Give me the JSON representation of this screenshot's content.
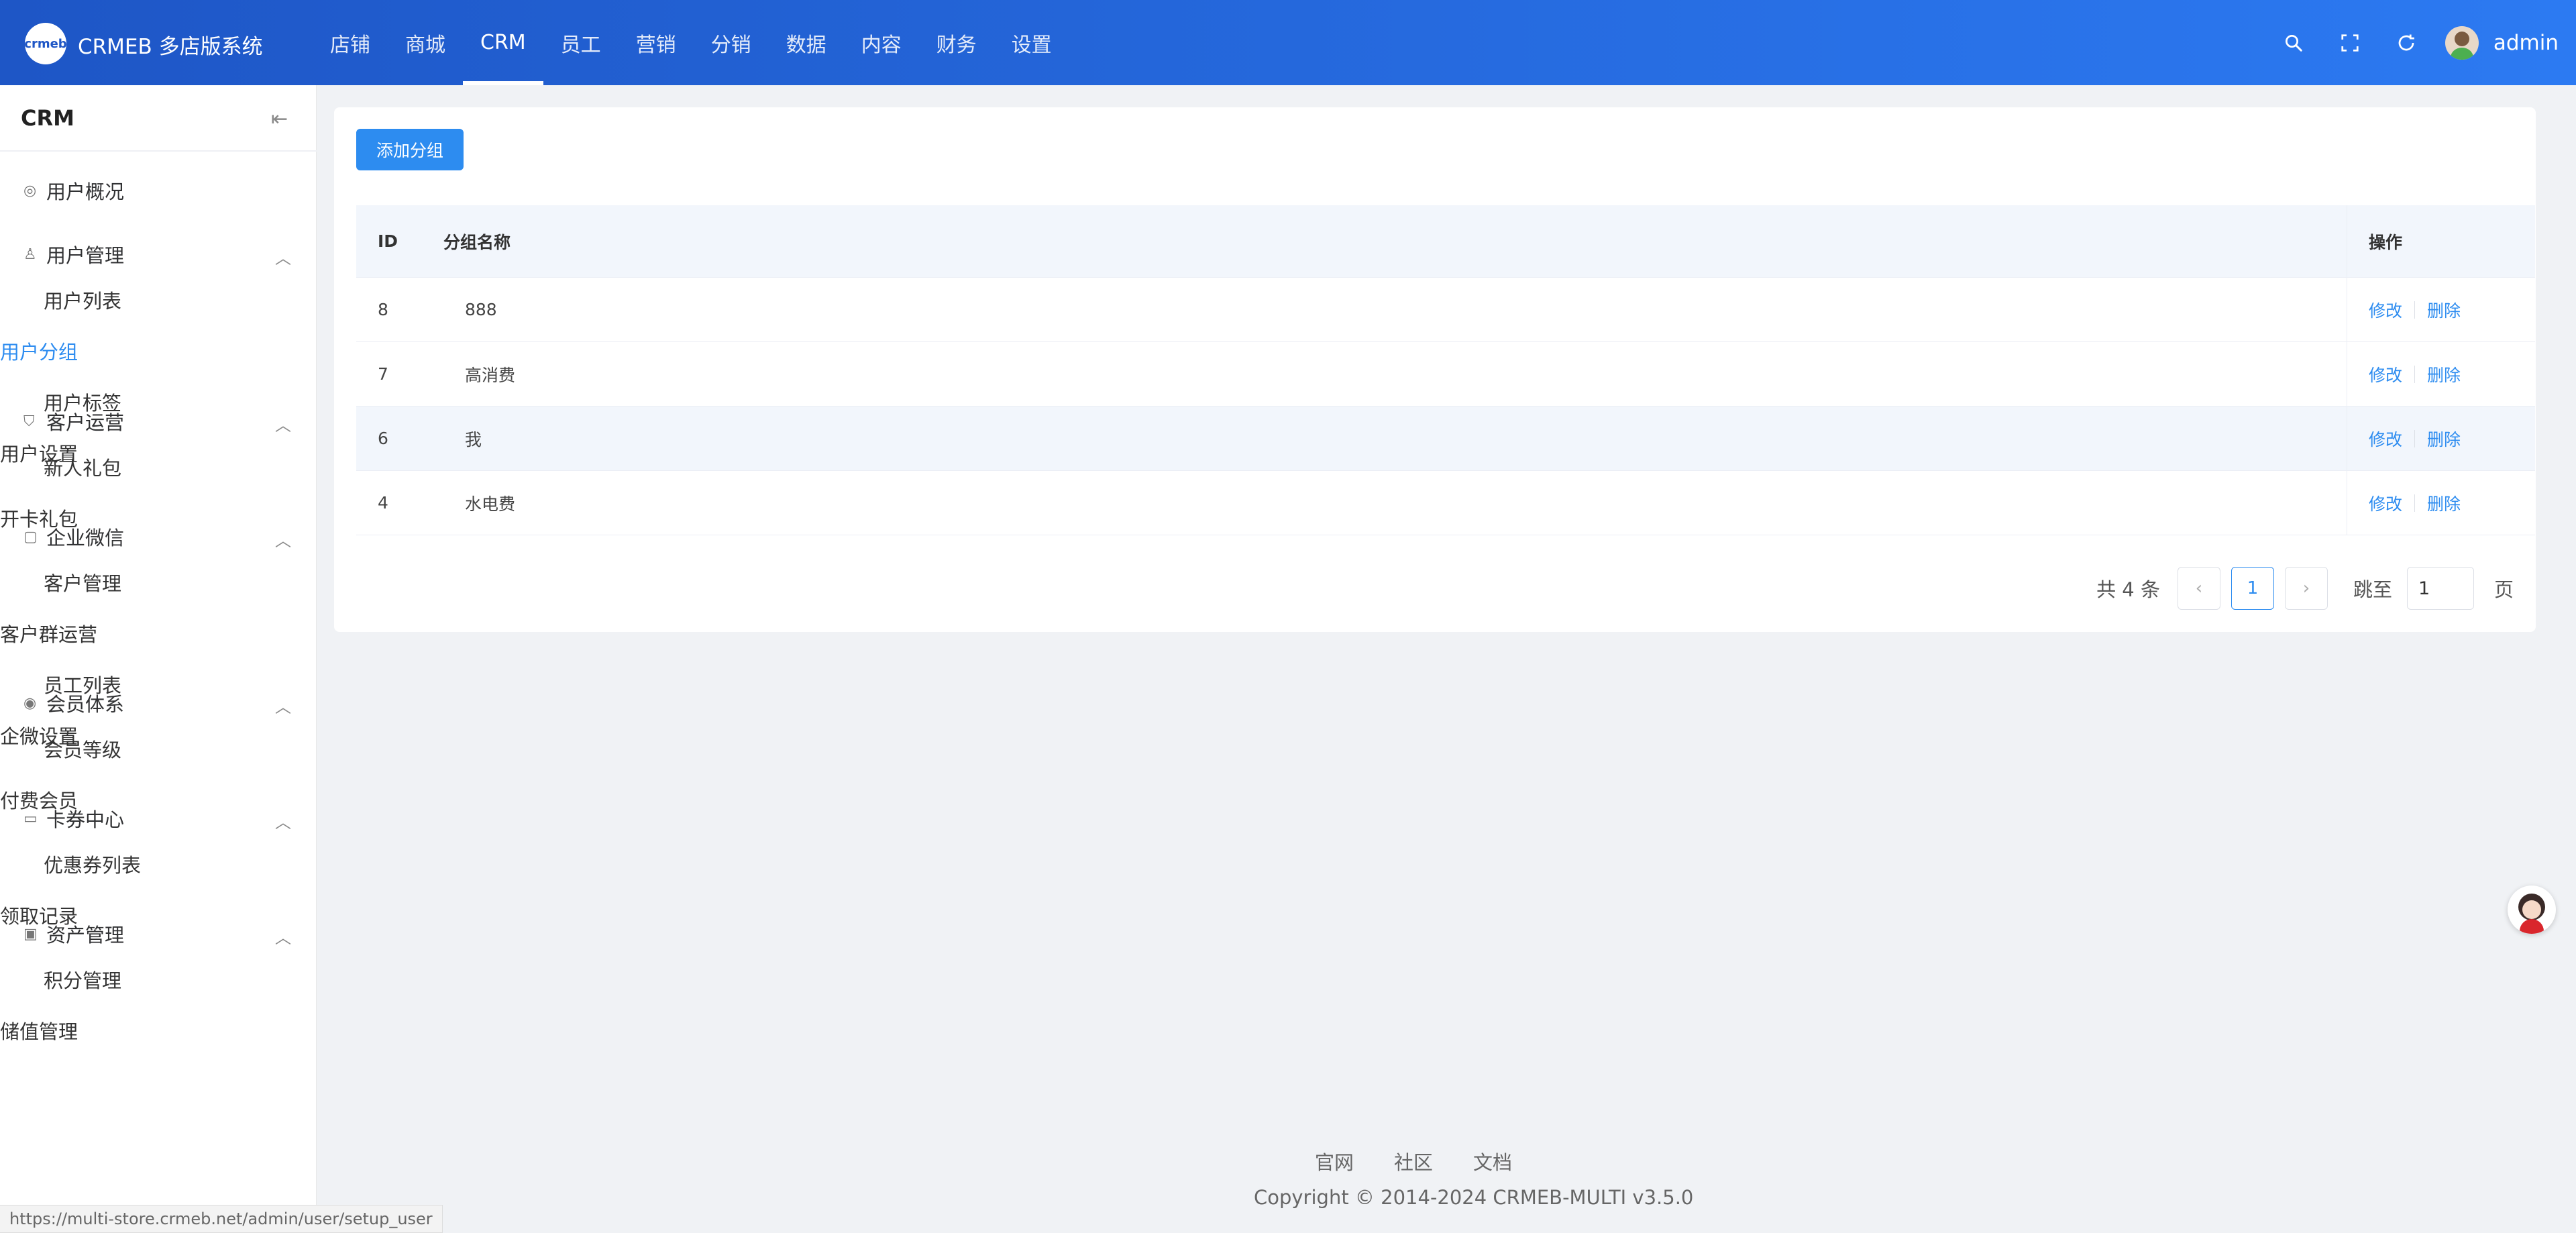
{
  "header": {
    "logo_text": "crmeb",
    "brand": "CRMEB 多店版系统",
    "nav": [
      "店铺",
      "商城",
      "CRM",
      "员工",
      "营销",
      "分销",
      "数据",
      "内容",
      "财务",
      "设置"
    ],
    "active_nav": "CRM",
    "user": "admin",
    "icons": [
      "search-icon",
      "fullscreen-icon",
      "refresh-icon"
    ]
  },
  "sidebar": {
    "title": "CRM",
    "collapse_icon": "collapse-left-icon",
    "groups": [
      {
        "label": "用户概况",
        "icon": "dashboard-icon",
        "items": []
      },
      {
        "label": "用户管理",
        "icon": "user-icon",
        "items": [
          "用户列表",
          "用户分组",
          "用户标签",
          "用户设置"
        ]
      },
      {
        "label": "客户运营",
        "icon": "shield-icon",
        "items": [
          "新人礼包",
          "开卡礼包"
        ]
      },
      {
        "label": "企业微信",
        "icon": "chat-icon",
        "items": [
          "客户管理",
          "客户群运营",
          "员工列表",
          "企微设置"
        ]
      },
      {
        "label": "会员体系",
        "icon": "member-icon",
        "items": [
          "会员等级",
          "付费会员"
        ]
      },
      {
        "label": "卡券中心",
        "icon": "card-icon",
        "items": [
          "优惠券列表",
          "领取记录"
        ]
      },
      {
        "label": "资产管理",
        "icon": "wallet-icon",
        "items": [
          "积分管理",
          "储值管理"
        ]
      }
    ],
    "active_item": "用户分组"
  },
  "main": {
    "add_button": "添加分组",
    "columns": {
      "id": "ID",
      "name": "分组名称",
      "op": "操作"
    },
    "rows": [
      {
        "id": "8",
        "name": "888"
      },
      {
        "id": "7",
        "name": "高消费"
      },
      {
        "id": "6",
        "name": "我"
      },
      {
        "id": "4",
        "name": "水电费"
      }
    ],
    "actions": {
      "edit": "修改",
      "delete": "删除"
    },
    "pagination": {
      "total": "共 4 条",
      "current": "1",
      "jump_label": "跳至",
      "jump_value": "1",
      "page_suffix": "页",
      "prev": "‹",
      "next": "›"
    }
  },
  "footer": {
    "links": [
      "官网",
      "社区",
      "文档"
    ],
    "copyright": "Copyright © 2014-2024 CRMEB-MULTI v3.5.0",
    "status_url": "https://multi-store.crmeb.net/admin/user/setup_user"
  }
}
